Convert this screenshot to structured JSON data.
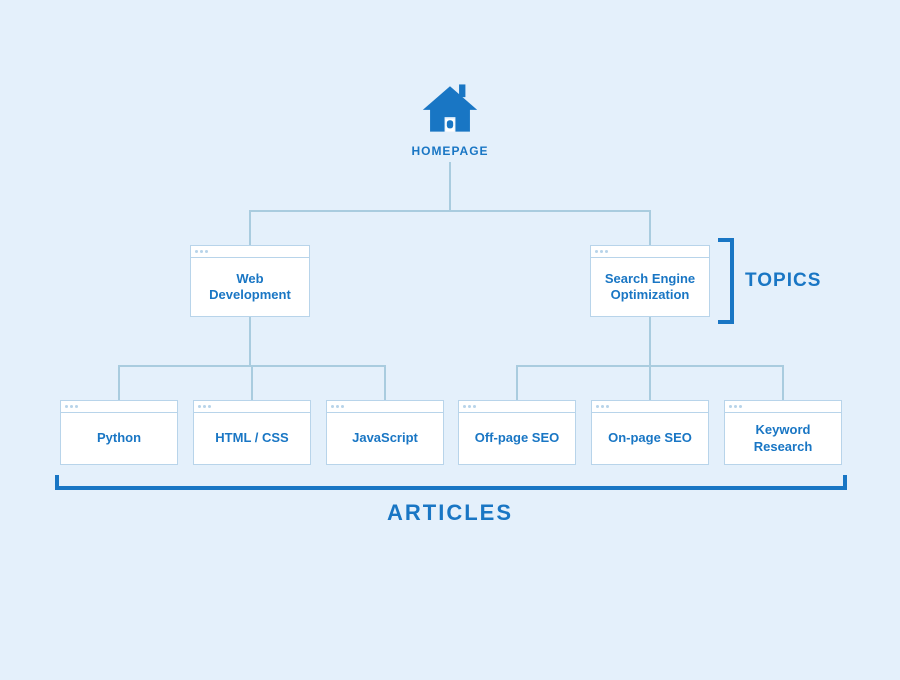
{
  "colors": {
    "background": "#e4f0fb",
    "primary": "#1976c4",
    "box_border": "#b8d4ea",
    "connector": "#a9ccdf",
    "box_bg": "#ffffff"
  },
  "root": {
    "icon": "house-icon",
    "label": "HOMEPAGE"
  },
  "topics_label": "TOPICS",
  "articles_label": "ARTICLES",
  "topics": [
    {
      "label": "Web Development",
      "articles": [
        {
          "label": "Python"
        },
        {
          "label": "HTML / CSS"
        },
        {
          "label": "JavaScript"
        }
      ]
    },
    {
      "label": "Search Engine Optimization",
      "articles": [
        {
          "label": "Off-page SEO"
        },
        {
          "label": "On-page SEO"
        },
        {
          "label": "Keyword Research"
        }
      ]
    }
  ]
}
